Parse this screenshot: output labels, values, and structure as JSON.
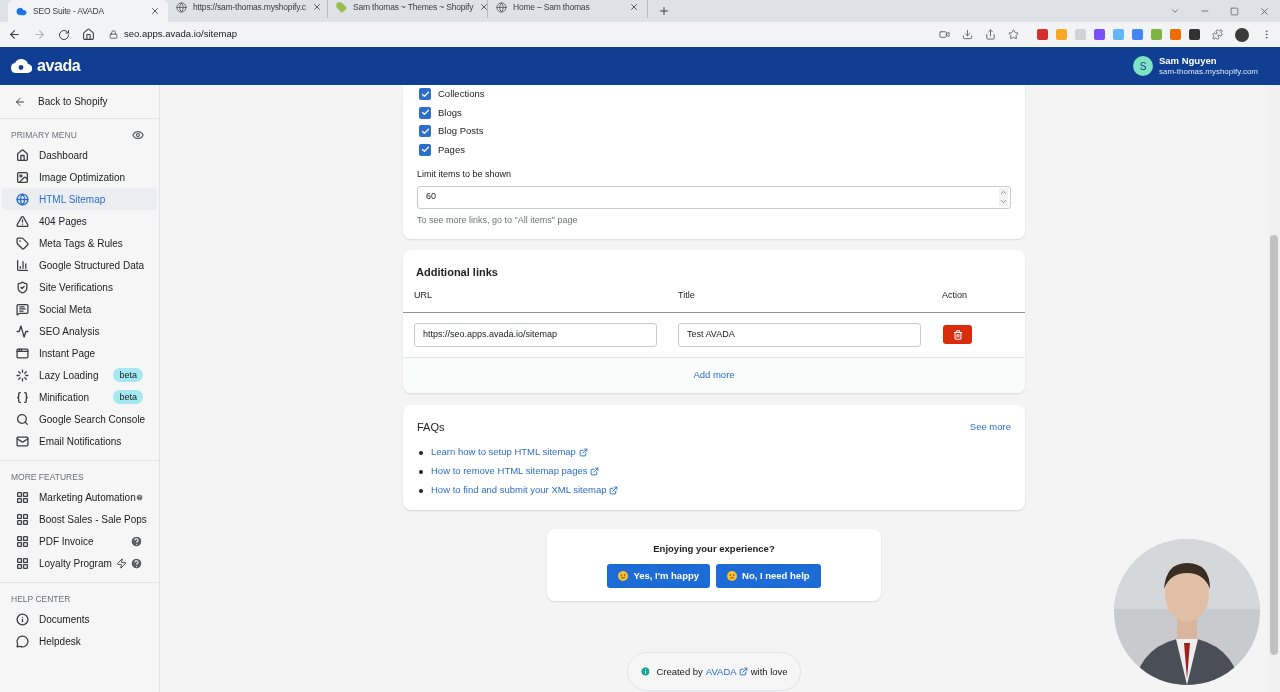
{
  "browser": {
    "tabs": [
      {
        "title": "SEO Suite - AVADA",
        "selected": true
      },
      {
        "title": "https://sam-thomas.myshopify.c",
        "selected": false
      },
      {
        "title": "Sam thomas ~ Themes ~ Shopify",
        "selected": false
      },
      {
        "title": "Home – Sam thomas",
        "selected": false
      }
    ],
    "address": "seo.apps.avada.io/sitemap"
  },
  "header": {
    "logo": "avada",
    "user": {
      "initial": "S",
      "name": "Sam Nguyen",
      "store": "sam-thomas.myshopify.com"
    }
  },
  "sidebar": {
    "back": "Back to Shopify",
    "sections": [
      {
        "heading": "PRIMARY MENU",
        "items": [
          {
            "label": "Dashboard",
            "selected": false,
            "kind": "menu"
          },
          {
            "label": "Image Optimization",
            "selected": false,
            "kind": "menu"
          },
          {
            "label": "HTML Sitemap",
            "selected": true,
            "kind": "menu"
          },
          {
            "label": "404 Pages",
            "selected": false,
            "kind": "menu"
          },
          {
            "label": "Meta Tags & Rules",
            "selected": false,
            "kind": "menu"
          },
          {
            "label": "Google Structured Data",
            "selected": false,
            "kind": "menu"
          },
          {
            "label": "Site Verifications",
            "selected": false,
            "kind": "menu"
          },
          {
            "label": "Social Meta",
            "selected": false,
            "kind": "menu"
          },
          {
            "label": "SEO Analysis",
            "selected": false,
            "kind": "menu"
          },
          {
            "label": "Instant Page",
            "selected": false,
            "kind": "menu"
          },
          {
            "label": "Lazy Loading",
            "selected": false,
            "kind": "menu",
            "badge": "beta"
          },
          {
            "label": "Minification",
            "selected": false,
            "kind": "menu",
            "badge": "beta"
          },
          {
            "label": "Google Search Console",
            "selected": false,
            "kind": "menu"
          },
          {
            "label": "Email Notifications",
            "selected": false,
            "kind": "menu"
          }
        ]
      },
      {
        "heading": "MORE FEATURES",
        "items": [
          {
            "label": "Marketing Automation",
            "selected": false,
            "kind": "feature"
          },
          {
            "label": "Boost Sales - Sale Pops",
            "selected": false,
            "kind": "feature"
          },
          {
            "label": "PDF Invoice",
            "selected": false,
            "kind": "feature"
          },
          {
            "label": "Loyalty Program",
            "selected": false,
            "kind": "feature_bolt"
          }
        ]
      },
      {
        "heading": "HELP CENTER",
        "items": [
          {
            "label": "Documents",
            "selected": false,
            "kind": "help"
          },
          {
            "label": "Helpdesk",
            "selected": false,
            "kind": "help"
          }
        ]
      }
    ]
  },
  "content": {
    "checkboxes": [
      {
        "label": "Collections",
        "checked": true
      },
      {
        "label": "Blogs",
        "checked": true
      },
      {
        "label": "Blog Posts",
        "checked": true
      },
      {
        "label": "Pages",
        "checked": true
      }
    ],
    "limit": {
      "label": "Limit items to be shown",
      "value": "60",
      "hint": "To see more links, go to \"All items\" page"
    },
    "additional_links": {
      "title": "Additional links",
      "columns": [
        "URL",
        "Title",
        "Action"
      ],
      "rows": [
        {
          "url": "https://seo.apps.avada.io/sitemap",
          "title": "Test AVADA"
        }
      ],
      "add_more": "Add more"
    },
    "faqs": {
      "title": "FAQs",
      "see_more": "See more",
      "links": [
        "Learn how to setup HTML sitemap",
        "How to remove HTML sitemap pages",
        "How to find and submit your XML sitemap"
      ]
    },
    "feedback": {
      "question": "Enjoying your experience?",
      "buttons": [
        "Yes, I'm happy",
        "No, I need help"
      ]
    },
    "footer": {
      "prefix": "Created by",
      "link": "AVADA",
      "suffix": "with love"
    }
  }
}
